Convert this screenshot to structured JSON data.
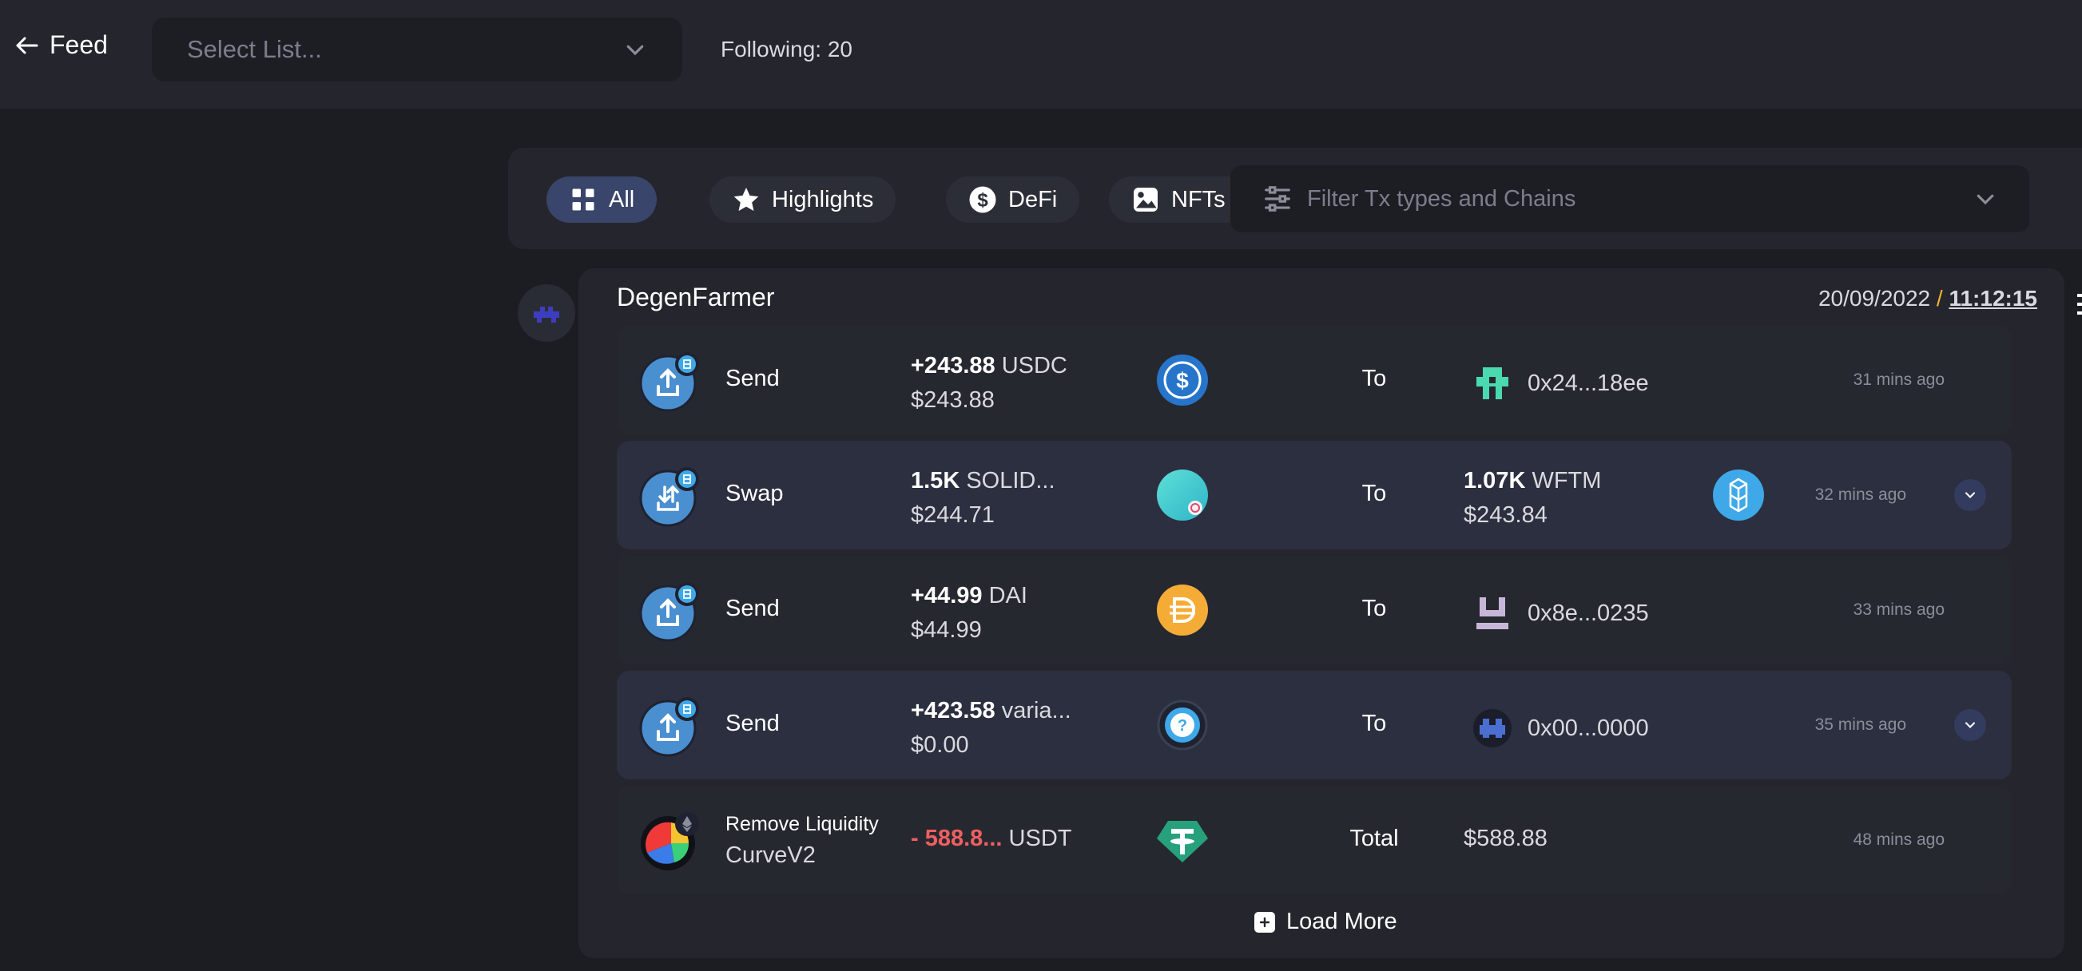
{
  "header": {
    "back_label": "Feed",
    "list_select_placeholder": "Select List...",
    "following": "Following: 20"
  },
  "filters": {
    "chips": [
      {
        "label": "All",
        "icon": "grid-icon",
        "active": true
      },
      {
        "label": "Highlights",
        "icon": "star-icon",
        "active": false
      },
      {
        "label": "DeFi",
        "icon": "dollar-icon",
        "active": false
      },
      {
        "label": "NFTs",
        "icon": "image-icon",
        "active": false
      }
    ],
    "tx_filter_placeholder": "Filter Tx types and Chains"
  },
  "feed": {
    "user": "DegenFarmer",
    "date": "20/09/2022",
    "separator": "/",
    "time": "11:12:15",
    "transactions": [
      {
        "type": "Send",
        "amount_value": "+243.88",
        "amount_token": "USDC",
        "usd": "$243.88",
        "direction": "To",
        "dest": "0x24...18ee",
        "ago": "31 mins ago"
      },
      {
        "type": "Swap",
        "amount_value": "1.5K",
        "amount_token": "SOLID...",
        "usd": "$244.71",
        "direction": "To",
        "dest_value": "1.07K",
        "dest_token": "WFTM",
        "dest_usd": "$243.84",
        "ago": "32 mins ago"
      },
      {
        "type": "Send",
        "amount_value": "+44.99",
        "amount_token": "DAI",
        "usd": "$44.99",
        "direction": "To",
        "dest": "0x8e...0235",
        "ago": "33 mins ago"
      },
      {
        "type": "Send",
        "amount_value": "+423.58",
        "amount_token": "varia...",
        "usd": "$0.00",
        "direction": "To",
        "dest": "0x00...0000",
        "ago": "35 mins ago"
      },
      {
        "type": "Remove Liquidity",
        "protocol": "CurveV2",
        "amount_value": "- 588.8...",
        "amount_token": "USDT",
        "direction": "Total",
        "dest": "$588.88",
        "ago": "48 mins ago"
      }
    ],
    "load_more": "Load More"
  },
  "colors": {
    "background": "#1c1d23",
    "panel": "#25262d",
    "active_chip": "#39456a",
    "negative": "#ef5f61",
    "accent_slash": "#f2b233"
  }
}
